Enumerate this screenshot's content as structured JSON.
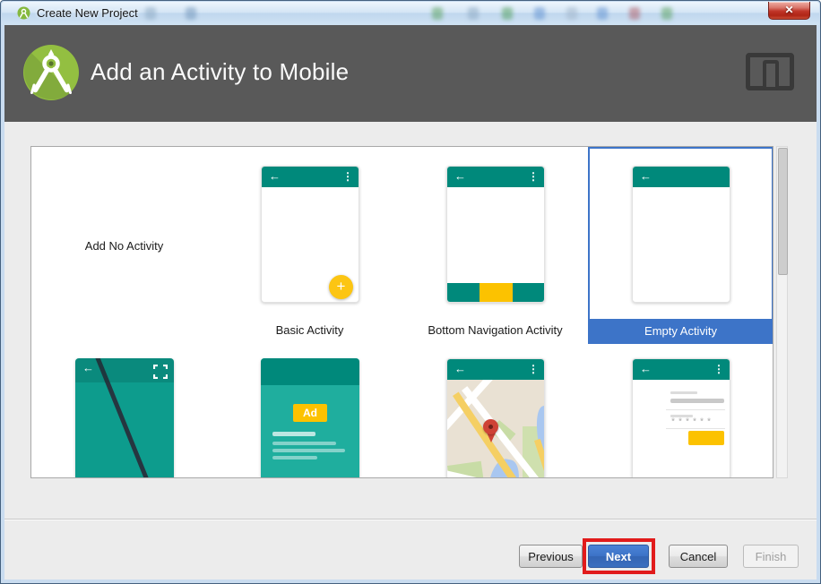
{
  "window": {
    "title": "Create New Project",
    "close_glyph": "✕"
  },
  "header": {
    "title": "Add an Activity to Mobile"
  },
  "gallery": {
    "row1": [
      {
        "label": "Add No Activity",
        "selected": false
      },
      {
        "label": "Basic Activity",
        "selected": false
      },
      {
        "label": "Bottom Navigation Activity",
        "selected": false
      },
      {
        "label": "Empty Activity",
        "selected": true
      }
    ],
    "row2": {
      "admob_ad_label": "Ad",
      "login_password_mask": "******"
    }
  },
  "footer": {
    "previous_label": "Previous",
    "next_label": "Next",
    "cancel_label": "Cancel",
    "finish_label": "Finish"
  },
  "colors": {
    "teal_header": "#00897b",
    "teal_body": "#1fae9e",
    "amber": "#fcc200",
    "selection_blue": "#3d74c8",
    "annotation_red": "#e11b1b",
    "wizard_header_gray": "#595959"
  }
}
